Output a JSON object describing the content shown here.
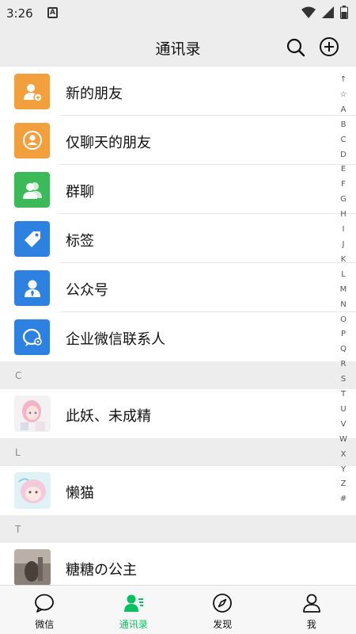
{
  "status_bar": {
    "time": "3:26",
    "badge": "A"
  },
  "header": {
    "title": "通讯录"
  },
  "features": [
    {
      "label": "新的朋友",
      "icon": "add-friend-icon",
      "color": "#f2a03d"
    },
    {
      "label": "仅聊天的朋友",
      "icon": "chat-only-friend-icon",
      "color": "#f2a03d"
    },
    {
      "label": "群聊",
      "icon": "group-chat-icon",
      "color": "#3cba5a"
    },
    {
      "label": "标签",
      "icon": "tag-icon",
      "color": "#2d81e0"
    },
    {
      "label": "公众号",
      "icon": "official-account-icon",
      "color": "#2d81e0"
    },
    {
      "label": "企业微信联系人",
      "icon": "work-contacts-icon",
      "color": "#2d81e0"
    }
  ],
  "sections": [
    {
      "letter": "C",
      "contacts": [
        {
          "name": "此妖、未成精"
        }
      ]
    },
    {
      "letter": "L",
      "contacts": [
        {
          "name": "懒猫"
        }
      ]
    },
    {
      "letter": "T",
      "contacts": [
        {
          "name": "糖糖の公主"
        }
      ]
    }
  ],
  "alphabet": [
    "↑",
    "☆",
    "A",
    "B",
    "C",
    "D",
    "E",
    "F",
    "G",
    "H",
    "I",
    "J",
    "K",
    "L",
    "M",
    "N",
    "O",
    "P",
    "Q",
    "R",
    "S",
    "T",
    "U",
    "V",
    "W",
    "X",
    "Y",
    "Z",
    "#"
  ],
  "tabs": [
    {
      "label": "微信",
      "icon": "chat-bubble-icon",
      "active": false
    },
    {
      "label": "通讯录",
      "icon": "contacts-icon",
      "active": true
    },
    {
      "label": "发现",
      "icon": "compass-icon",
      "active": false
    },
    {
      "label": "我",
      "icon": "person-icon",
      "active": false
    }
  ],
  "colors": {
    "accent": "#07c160",
    "background": "#ededed"
  }
}
